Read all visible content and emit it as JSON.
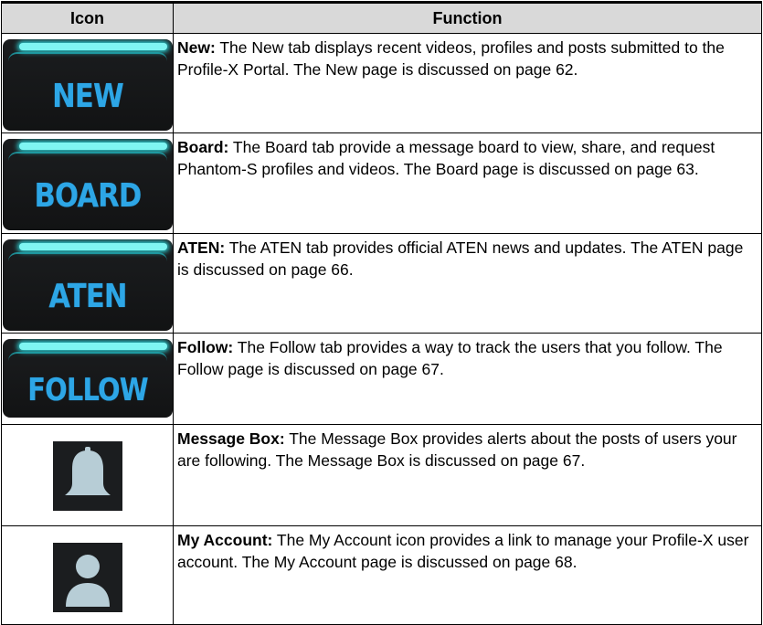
{
  "table": {
    "headers": {
      "icon": "Icon",
      "function": "Function"
    },
    "rows": [
      {
        "icon_text": "NEW",
        "icon_name": "new-tab-icon",
        "title": "New:",
        "text": " The New tab displays recent videos, profiles and posts submitted to the Profile-X Portal. The New page is discussed on page 62."
      },
      {
        "icon_text": "BOARD",
        "icon_name": "board-tab-icon",
        "title": "Board:",
        "text": " The Board tab provide a message board to view, share, and request Phantom-S profiles and videos. The Board page is discussed on page 63."
      },
      {
        "icon_text": "ATEN",
        "icon_name": "aten-tab-icon",
        "title": "ATEN:",
        "text": " The ATEN tab provides official ATEN news and updates. The ATEN page is discussed on page 66."
      },
      {
        "icon_text": "FOLLOW",
        "icon_name": "follow-tab-icon",
        "title": "Follow:",
        "text": " The Follow tab provides a way to track the users that you follow. The Follow page is discussed on page 67."
      },
      {
        "icon_text": "",
        "icon_name": "bell-icon",
        "title": "Message Box:",
        "text": " The Message Box provides alerts about the posts of users your are following. The Message Box is discussed on page 67."
      },
      {
        "icon_text": "",
        "icon_name": "user-icon",
        "title": "My Account:",
        "text": " The My Account icon provides a link to manage your Profile-X user account. The My Account page is discussed on page 68."
      }
    ]
  },
  "colors": {
    "header_bg": "#d9d9d9",
    "tab_bg": "#1b1d1f",
    "tab_text": "#2da6e6",
    "tab_glow": "#7ff5f2",
    "icon_fill": "#b7cdd6"
  }
}
